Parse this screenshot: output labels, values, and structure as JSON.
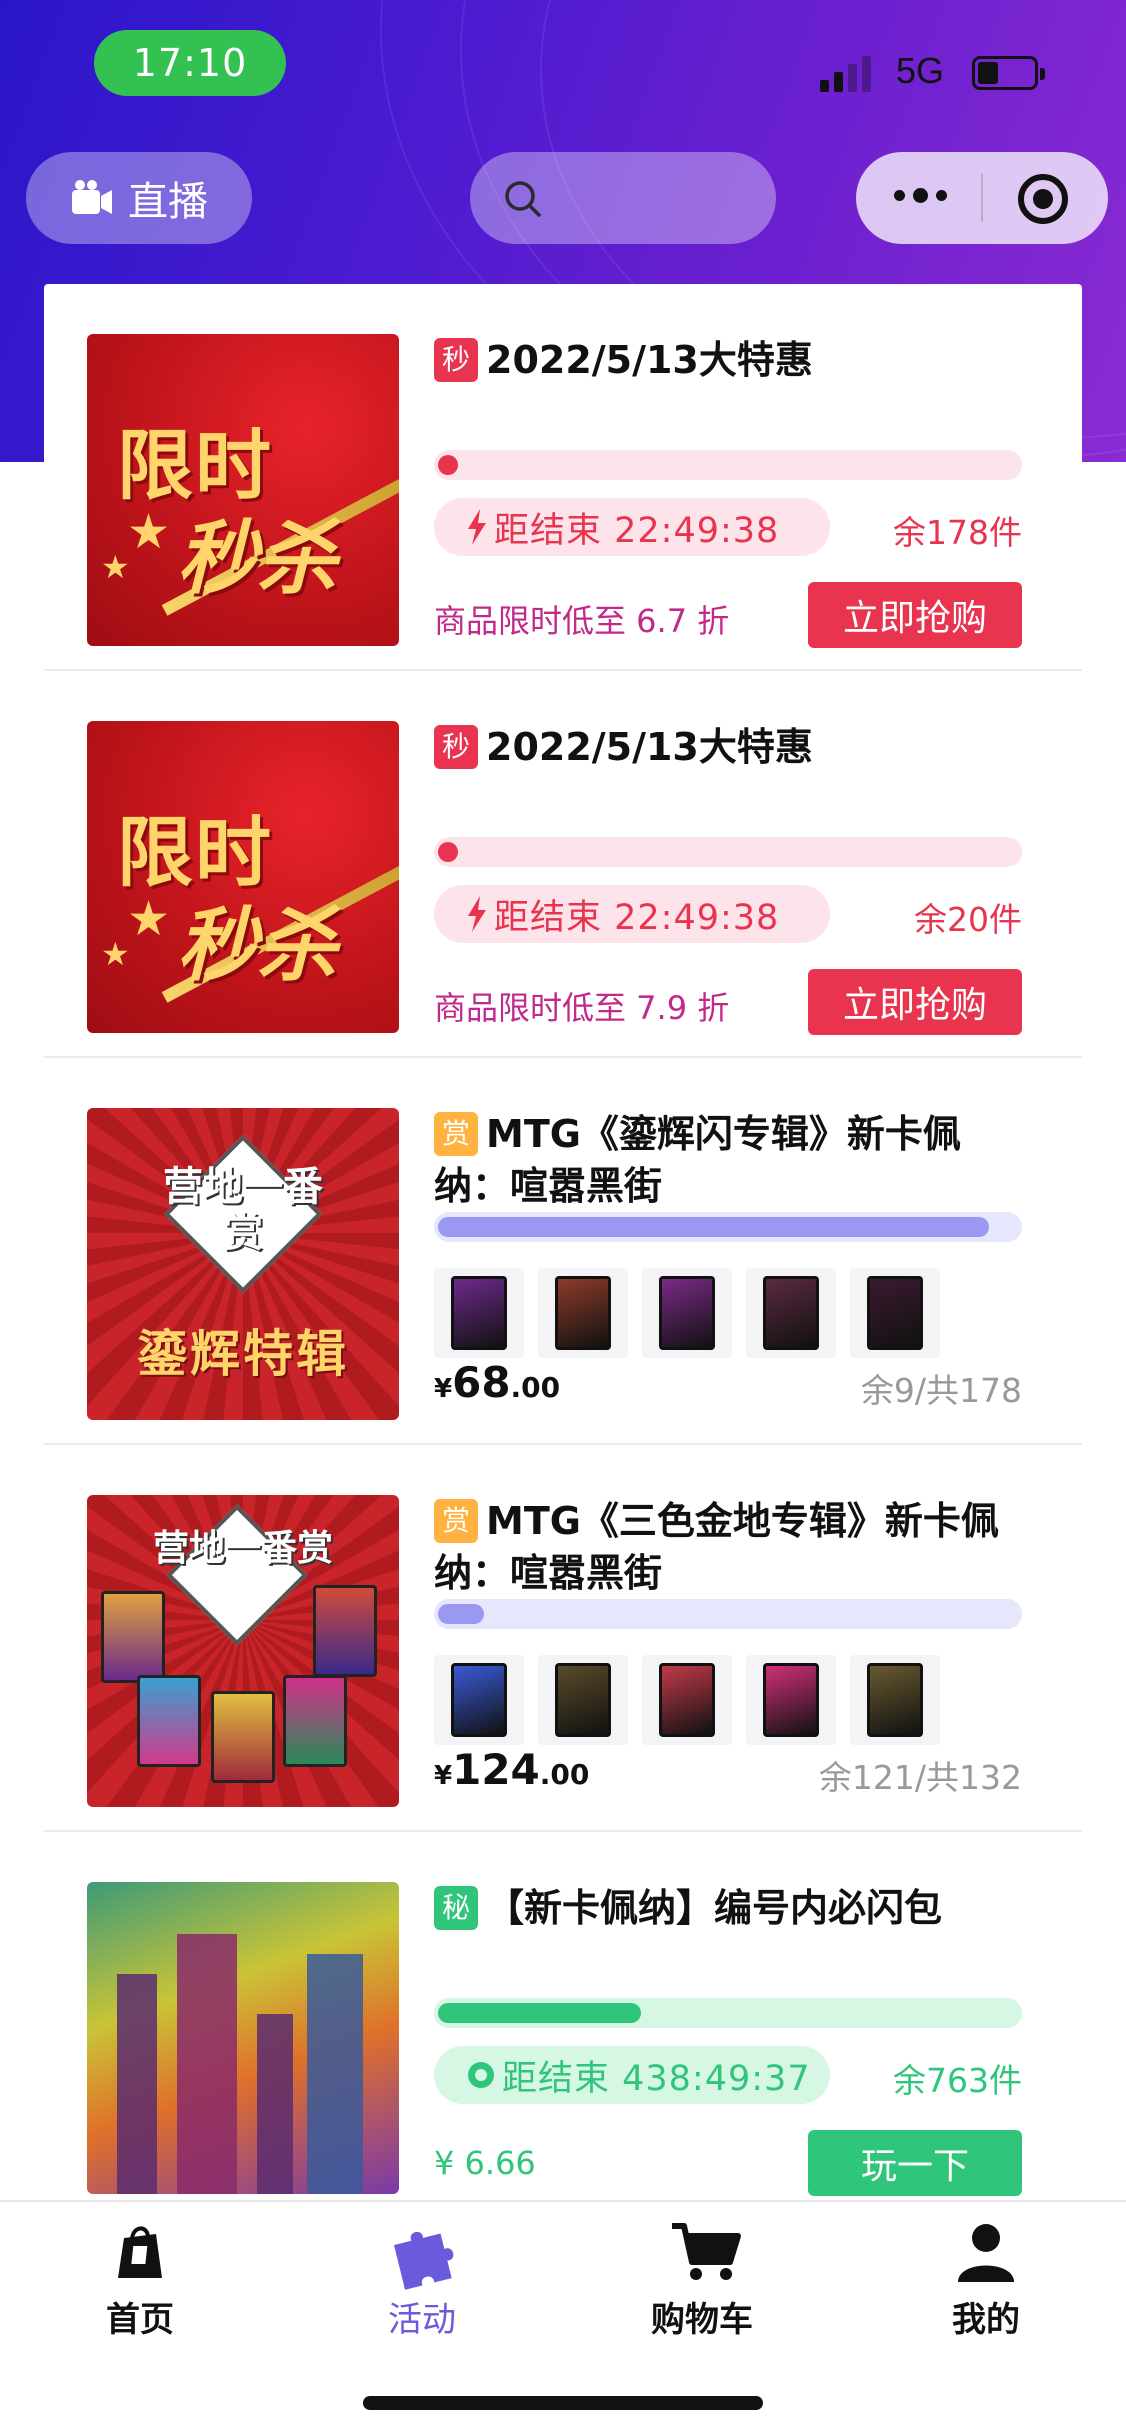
{
  "status_bar": {
    "time": "17:10",
    "network": "5G"
  },
  "header": {
    "live_label": "直播"
  },
  "items": [
    {
      "tag": "秒",
      "title": "2022/5/13大特惠",
      "countdown": "距结束 22:49:38",
      "remain": "余178件",
      "discount": "商品限时低至 6.7 折",
      "cta": "立即抢购",
      "progress": 0.03,
      "thumb": {
        "line1": "限时",
        "line2": "秒杀"
      }
    },
    {
      "tag": "秒",
      "title": "2022/5/13大特惠",
      "countdown": "距结束 22:49:38",
      "remain": "余20件",
      "discount": "商品限时低至 7.9 折",
      "cta": "立即抢购",
      "progress": 0.02,
      "thumb": {
        "line1": "限时",
        "line2": "秒杀"
      }
    },
    {
      "tag": "赏",
      "title": "MTG《鎏辉闪专辑》新卡佩纳：喧嚣黑街",
      "price_currency": "¥",
      "price_int": "68",
      "price_dec": ".00",
      "remain": "余9/共178",
      "progress": 0.95,
      "thumb": {
        "logo": "营地一番赏",
        "caption": "鎏辉特辑"
      },
      "cards": [
        "#6d2a8a",
        "#8c3b2a",
        "#7a2a86",
        "#5a2a40",
        "#3a1a30"
      ]
    },
    {
      "tag": "赏",
      "title": "MTG《三色金地专辑》新卡佩纳：喧嚣黑街",
      "price_currency": "¥",
      "price_int": "124",
      "price_dec": ".00",
      "remain": "余121/共132",
      "progress": 0.08,
      "thumb": {
        "logo": "营地一番赏"
      },
      "cards": [
        "#3a5ad8",
        "#5a4a2a",
        "#c03a4a",
        "#d0307a",
        "#6a5a30"
      ]
    },
    {
      "tag": "秘",
      "title": "【新卡佩纳】编号内必闪包",
      "countdown": "距结束 438:49:37",
      "remain": "余763件",
      "price": "¥ 6.66",
      "cta": "玩一下",
      "progress": 0.35
    }
  ],
  "tabs": [
    {
      "label": "首页",
      "icon": "shopping-bag-icon"
    },
    {
      "label": "活动",
      "icon": "puzzle-icon",
      "active": true
    },
    {
      "label": "购物车",
      "icon": "cart-icon"
    },
    {
      "label": "我的",
      "icon": "user-icon"
    }
  ],
  "colors": {
    "red_accent": "#e8344e",
    "red_track": "#fde4ea",
    "lilac_bar": "#9a98f0",
    "lilac_track": "#e6e6fd",
    "green": "#2fc57b",
    "green_track": "#d6f7e4",
    "tab_active": "#6a5bdc"
  }
}
